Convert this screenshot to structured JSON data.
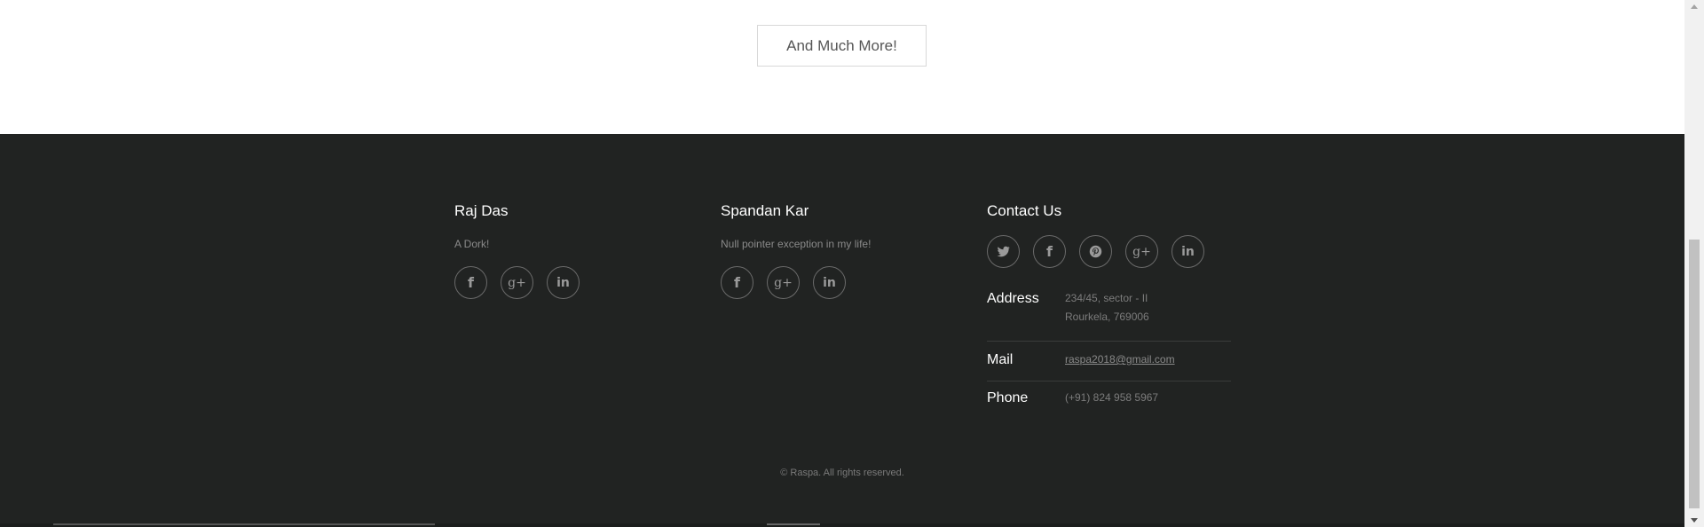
{
  "main": {
    "more_label": "And Much More!"
  },
  "footer": {
    "members": [
      {
        "name": "Raj Das",
        "tagline": "A Dork!",
        "icons": [
          "facebook-icon",
          "google-plus-icon",
          "linkedin-icon"
        ]
      },
      {
        "name": "Spandan Kar",
        "tagline": "Null pointer exception in my life!",
        "icons": [
          "facebook-icon",
          "google-plus-icon",
          "linkedin-icon"
        ]
      }
    ],
    "contact": {
      "title": "Contact Us",
      "icons": [
        "twitter-icon",
        "facebook-icon",
        "pinterest-icon",
        "google-plus-icon",
        "linkedin-icon"
      ],
      "address_label": "Address",
      "address_line1": "234/45, sector - II",
      "address_line2": "Rourkela, 769006",
      "mail_label": "Mail",
      "mail_value": "raspa2018@gmail.com",
      "phone_label": "Phone",
      "phone_value": "(+91) 824 958 5967"
    },
    "copyright": "© Raspa. All rights reserved."
  },
  "colors": {
    "footer_bg": "#212322",
    "text_muted": "#8a8a8a",
    "heading": "#ffffff"
  }
}
